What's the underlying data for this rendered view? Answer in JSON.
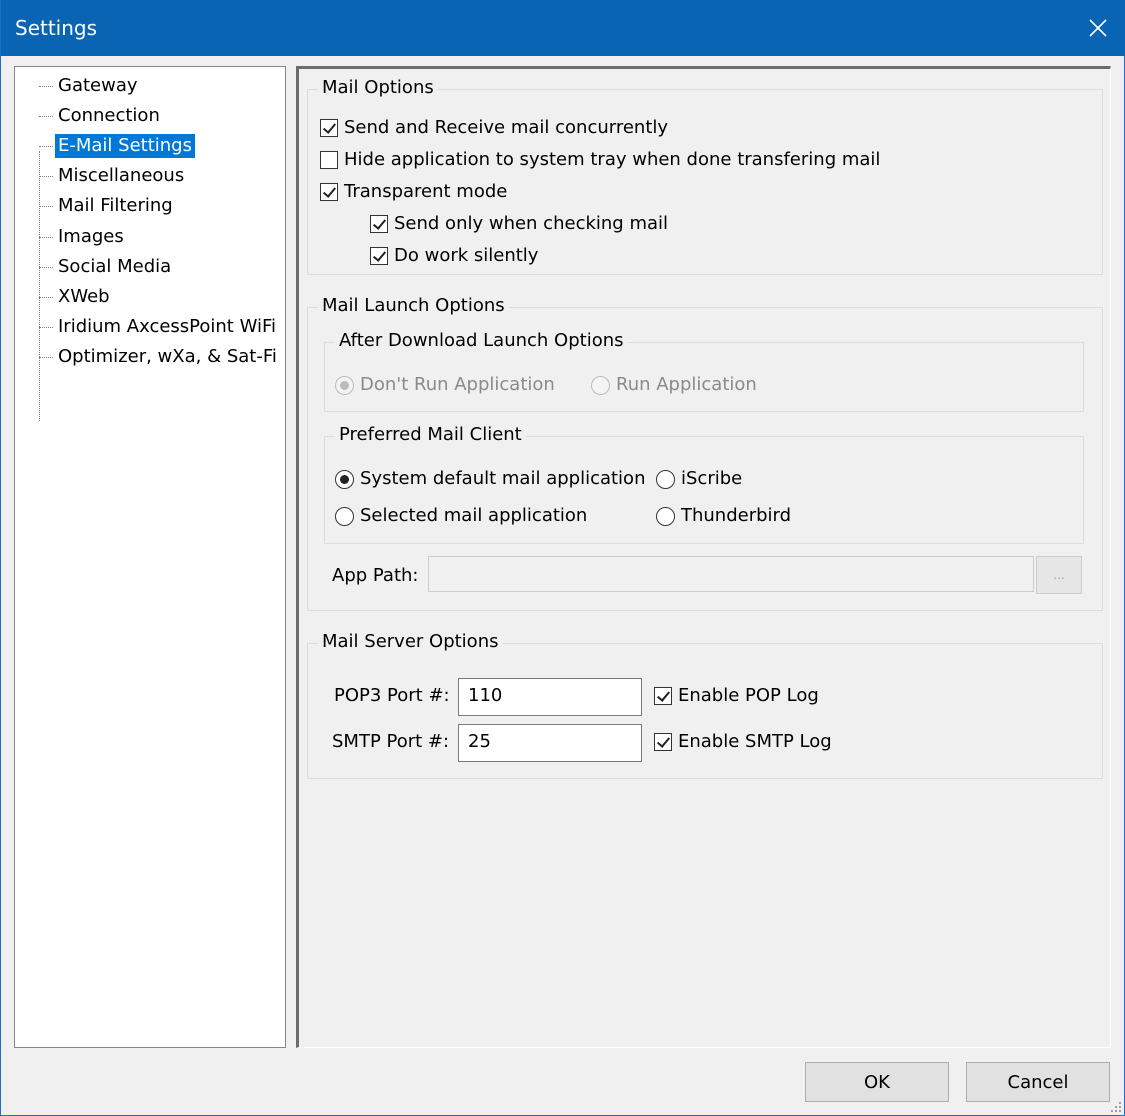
{
  "window": {
    "title": "Settings"
  },
  "tree": {
    "items": [
      {
        "label": "Gateway"
      },
      {
        "label": "Connection"
      },
      {
        "label": "E-Mail Settings"
      },
      {
        "label": "Miscellaneous"
      },
      {
        "label": "Mail Filtering"
      },
      {
        "label": "Images"
      },
      {
        "label": "Social Media"
      },
      {
        "label": "XWeb"
      },
      {
        "label": "Iridium AxcessPoint WiFi"
      },
      {
        "label": "Optimizer, wXa, & Sat-Fi"
      }
    ],
    "selected": "E-Mail Settings"
  },
  "mail_options": {
    "title": "Mail Options",
    "send_receive_concurrently": {
      "label": "Send and Receive mail concurrently",
      "checked": true
    },
    "hide_to_tray": {
      "label": "Hide application to system tray when done transfering mail",
      "checked": false
    },
    "transparent_mode": {
      "label": "Transparent mode",
      "checked": true
    },
    "send_only_when_checking": {
      "label": "Send only when checking mail",
      "checked": true
    },
    "work_silently": {
      "label": "Do work silently",
      "checked": true
    }
  },
  "mail_launch": {
    "title": "Mail Launch Options",
    "after_download": {
      "title": "After Download Launch Options",
      "dont_run": {
        "label": "Don't Run Application",
        "selected": true
      },
      "run": {
        "label": "Run Application",
        "selected": false
      }
    },
    "preferred_client": {
      "title": "Preferred Mail Client",
      "system_default": {
        "label": "System default mail application",
        "selected": true
      },
      "iscribe": {
        "label": "iScribe",
        "selected": false
      },
      "selected_app": {
        "label": "Selected mail application",
        "selected": false
      },
      "thunderbird": {
        "label": "Thunderbird",
        "selected": false
      }
    },
    "app_path": {
      "label": "App Path:",
      "value": "",
      "browse_label": "..."
    }
  },
  "mail_server": {
    "title": "Mail Server Options",
    "pop3": {
      "label": "POP3 Port #:",
      "value": "110",
      "log_label": "Enable POP Log",
      "log_checked": true
    },
    "smtp": {
      "label": "SMTP Port #:",
      "value": "25",
      "log_label": "Enable SMTP Log",
      "log_checked": true
    }
  },
  "buttons": {
    "ok": "OK",
    "cancel": "Cancel"
  }
}
